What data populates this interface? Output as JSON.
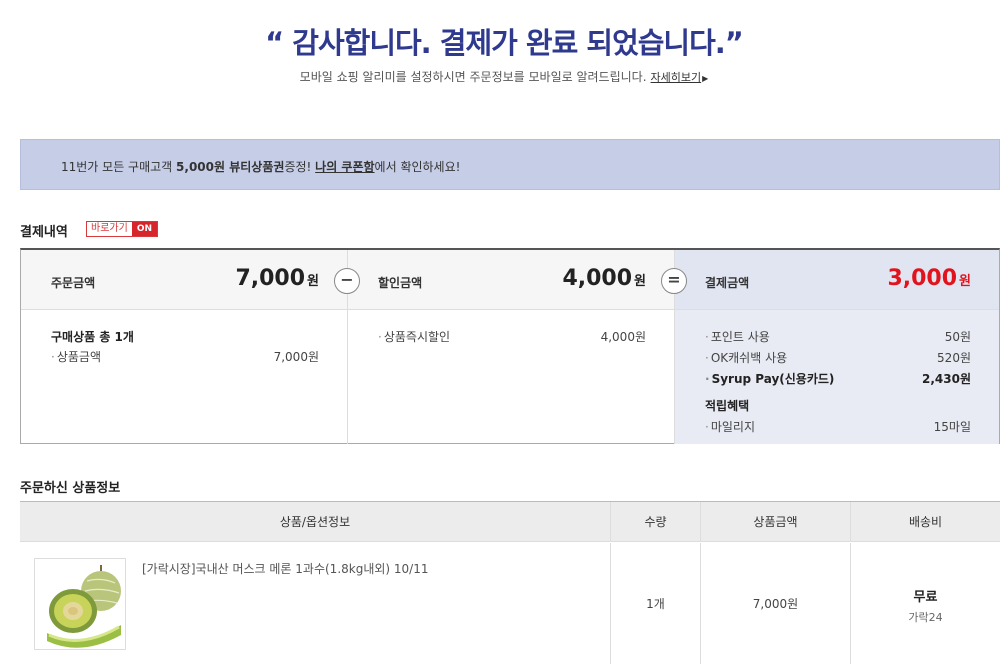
{
  "hero": {
    "title": "“ 감사합니다. 결제가 완료 되었습니다.”",
    "subtitle": "모바일 쇼핑 알리미를 설정하시면 주문정보를 모바일로 알려드립니다.",
    "more_link": "자세히보기"
  },
  "banner": {
    "part1": "11번가 모든 구매고객 ",
    "highlight": "5,000원 뷰티상품권",
    "part2": "증정! ",
    "link": "나의 쿠폰함",
    "part3": "에서 확인하세요!"
  },
  "payment": {
    "section_title": "결제내역",
    "shortcut_label": "바로가기",
    "shortcut_on": "ON",
    "operators": {
      "minus": "−",
      "equals": "="
    },
    "order": {
      "label": "주문금액",
      "amount": "7,000",
      "unit": "원",
      "group_title": "구매상품 총 1개",
      "rows": [
        {
          "label": "상품금액",
          "value": "7,000원"
        }
      ]
    },
    "discount": {
      "label": "할인금액",
      "amount": "4,000",
      "unit": "원",
      "rows": [
        {
          "label": "상품즉시할인",
          "value": "4,000원"
        }
      ]
    },
    "total": {
      "label": "결제금액",
      "amount": "3,000",
      "unit": "원",
      "rows": [
        {
          "label": "포인트 사용",
          "value": "50원"
        },
        {
          "label": "OK캐쉬백 사용",
          "value": "520원"
        },
        {
          "label": "Syrup Pay(신용카드)",
          "value": "2,430원"
        }
      ],
      "benefit_title": "적립혜택",
      "benefit_rows": [
        {
          "label": "마일리지",
          "value": "15마일"
        }
      ]
    },
    "colors": {
      "accent_red": "#e1141d",
      "title_blue": "#2f3a8f",
      "banner_bg": "#c6cde6"
    }
  },
  "order_info": {
    "section_title": "주문하신 상품정보",
    "columns": [
      "상품/옵션정보",
      "수량",
      "상품금액",
      "배송비"
    ],
    "items": [
      {
        "name": "[가락시장]국내산 머스크 메론 1과수(1.8kg내외) 10/11",
        "qty": "1개",
        "price": "7,000원",
        "shipping": "무료",
        "shipping_from": "가락24"
      }
    ]
  }
}
